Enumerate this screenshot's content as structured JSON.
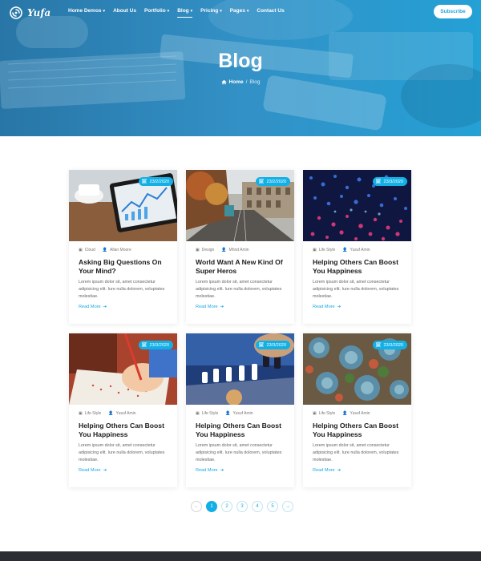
{
  "brand": {
    "name": "Yufa"
  },
  "nav": {
    "items": [
      {
        "label": "Home Demos",
        "dropdown": true,
        "active": false
      },
      {
        "label": "About Us",
        "dropdown": false,
        "active": false
      },
      {
        "label": "Portfolio",
        "dropdown": true,
        "active": false
      },
      {
        "label": "Blog",
        "dropdown": true,
        "active": true
      },
      {
        "label": "Pricing",
        "dropdown": true,
        "active": false
      },
      {
        "label": "Pages",
        "dropdown": true,
        "active": false
      },
      {
        "label": "Contact Us",
        "dropdown": false,
        "active": false
      }
    ],
    "subscribe_label": "Subscribe"
  },
  "hero": {
    "title": "Blog",
    "breadcrumb": {
      "home": "Home",
      "separator": "/",
      "current": "Blog"
    }
  },
  "posts": [
    {
      "date": "23/2/2020",
      "category": "Cloud",
      "author": "Allan Moore",
      "title": "Asking Big Questions On Your Mind?",
      "excerpt": "Lorem ipsum dolor sit, amet consectetur adipisicing elit. Iure nulla dolorem, voluptates molestiae.",
      "read_more": "Read More",
      "image": "tablet-chart"
    },
    {
      "date": "23/2/2020",
      "category": "Design",
      "author": "Mhnd Amin",
      "title": "World Want A New Kind Of Super Heros",
      "excerpt": "Lorem ipsum dolor sit, amet consectetur adipisicing elit. Iure nulla dolorem, voluptates molestiae.",
      "read_more": "Read More",
      "image": "city-street"
    },
    {
      "date": "23/3/2020",
      "category": "Life Style",
      "author": "Yusuf Amin",
      "title": "Helping Others Can Boost You Happiness",
      "excerpt": "Lorem ipsum dolor sit, amet consectetur adipisicing elit. Iure nulla dolorem, voluptates molestiae.",
      "read_more": "Read More",
      "image": "light-installation"
    },
    {
      "date": "23/3/2020",
      "category": "Life Style",
      "author": "Yusuf Amin",
      "title": "Helping Others Can Boost You Happiness",
      "excerpt": "Lorem ipsum dolor sit, amet consectetur adipisicing elit. Iure nulla dolorem, voluptates molestiae.",
      "read_more": "Read More",
      "image": "child-drawing"
    },
    {
      "date": "23/3/2020",
      "category": "Life Style",
      "author": "Yusuf Amin",
      "title": "Helping Others Can Boost You Happiness",
      "excerpt": "Lorem ipsum dolor sit, amet consectetur adipisicing elit. Iure nulla dolorem, voluptates molestiae.",
      "read_more": "Read More",
      "image": "chess-board"
    },
    {
      "date": "23/3/2020",
      "category": "Life Style",
      "author": "Yusuf Amin",
      "title": "Helping Others Can Boost You Happiness",
      "excerpt": "Lorem ipsum dolor sit, amet consectetur adipisicing elit. Iure nulla dolorem, voluptates molestiae.",
      "read_more": "Read More",
      "image": "succulents"
    }
  ],
  "pagination": {
    "pages": [
      "1",
      "2",
      "3",
      "4",
      "5"
    ],
    "current": "1"
  },
  "colors": {
    "accent": "#14aee6",
    "hero_overlay": "#2a9fd6",
    "footer": "#2c2d32"
  }
}
